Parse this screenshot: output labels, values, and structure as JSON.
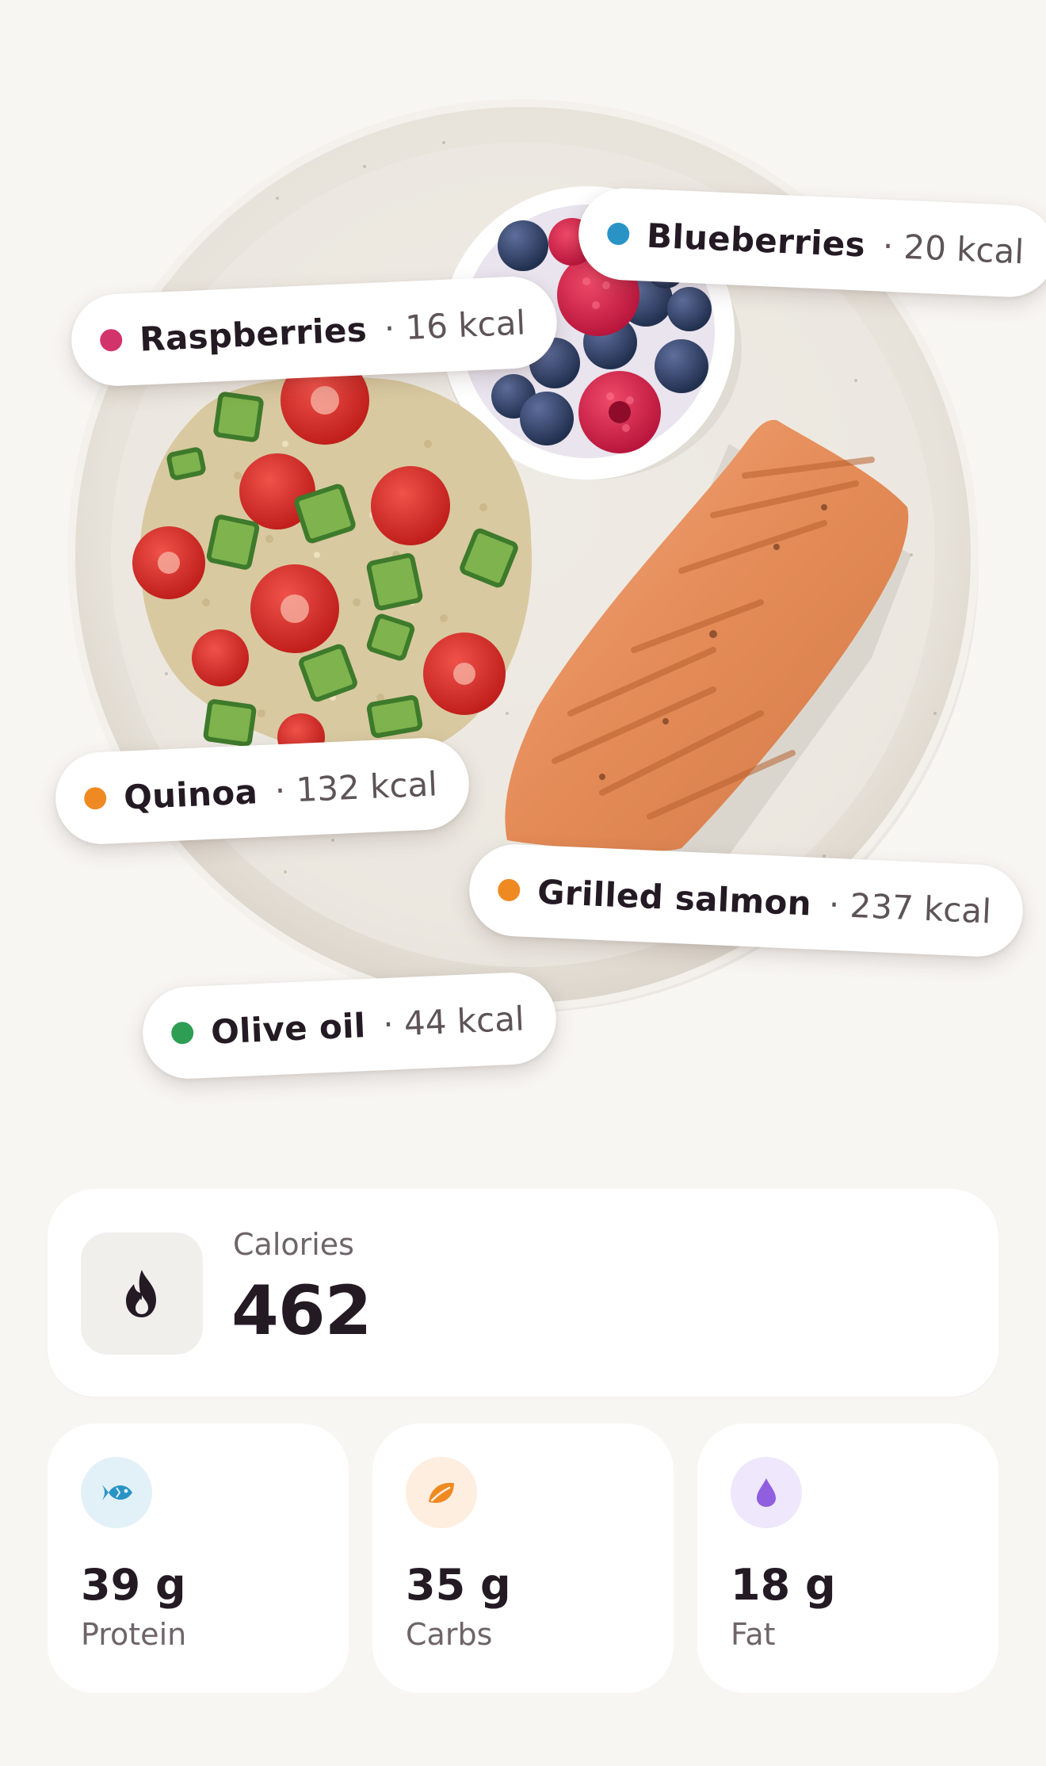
{
  "food_labels": [
    {
      "name": "Blueberries",
      "kcal": "· 20 kcal",
      "dot_color": "#2a93c6"
    },
    {
      "name": "Raspberries",
      "kcal": "· 16 kcal",
      "dot_color": "#d2336a"
    },
    {
      "name": "Quinoa",
      "kcal": "· 132 kcal",
      "dot_color": "#ef8a22"
    },
    {
      "name": "Grilled salmon",
      "kcal": "· 237 kcal",
      "dot_color": "#ef8a22"
    },
    {
      "name": "Olive oil",
      "kcal": "· 44 kcal",
      "dot_color": "#2e9e55"
    }
  ],
  "calories": {
    "label": "Calories",
    "value": "462",
    "icon": "flame-icon"
  },
  "macros": [
    {
      "value": "39 g",
      "label": "Protein",
      "icon": "fish-icon",
      "icon_color": "#2a93c6",
      "bg_color": "#e2f1f7"
    },
    {
      "value": "35 g",
      "label": "Carbs",
      "icon": "leaf-icon",
      "icon_color": "#ef8a22",
      "bg_color": "#fdeee0"
    },
    {
      "value": "18 g",
      "label": "Fat",
      "icon": "drop-icon",
      "icon_color": "#8f5fe0",
      "bg_color": "#efe7fb"
    }
  ]
}
